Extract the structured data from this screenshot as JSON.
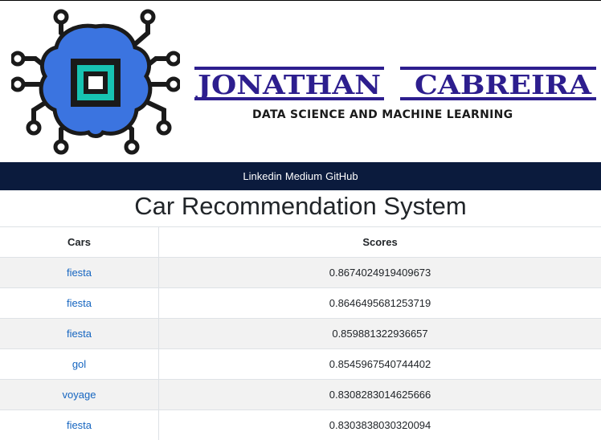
{
  "brand": {
    "name_first": "JONATHAN",
    "name_last": "CABREIRA",
    "tagline": "DATA SCIENCE AND MACHINE LEARNING"
  },
  "nav": [
    "Linkedin",
    "Medium",
    "GitHub"
  ],
  "title": "Car Recommendation System",
  "table": {
    "headers": [
      "Cars",
      "Scores"
    ],
    "rows": [
      {
        "car": "fiesta",
        "score": "0.8674024919409673"
      },
      {
        "car": "fiesta",
        "score": "0.8646495681253719"
      },
      {
        "car": "fiesta",
        "score": "0.859881322936657"
      },
      {
        "car": "gol",
        "score": "0.8545967540744402"
      },
      {
        "car": "voyage",
        "score": "0.8308283014625666"
      },
      {
        "car": "fiesta",
        "score": "0.8303838030320094"
      }
    ]
  },
  "colors": {
    "navbar": "#0b1b3d",
    "brand_text": "#2d1e8e",
    "logo_brain": "#3b74e0",
    "link": "#1565c0"
  }
}
